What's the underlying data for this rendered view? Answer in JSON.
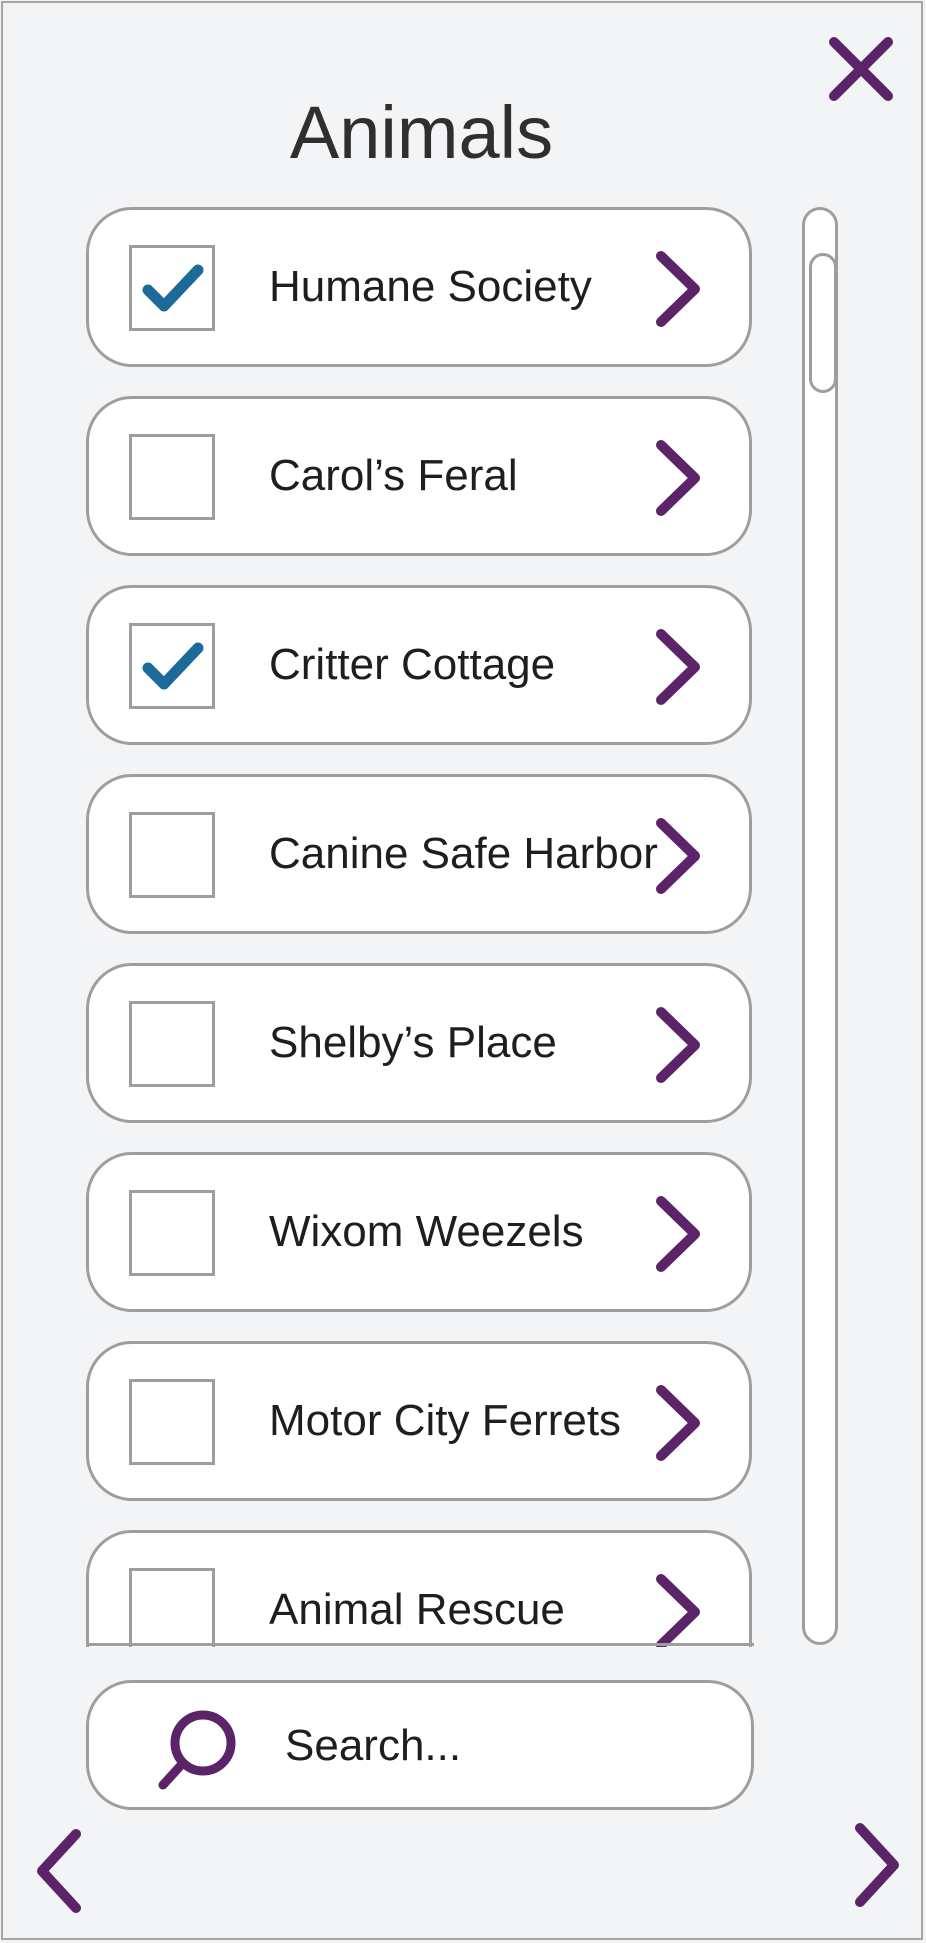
{
  "panel": {
    "title": "Animals",
    "close_icon": "close-icon",
    "accent_color": "#5c2468",
    "check_color": "#1c6a9a"
  },
  "list": {
    "items": [
      {
        "label": "Humane Society",
        "checked": true
      },
      {
        "label": "Carol’s Feral",
        "checked": false
      },
      {
        "label": "Critter Cottage",
        "checked": true
      },
      {
        "label": "Canine Safe Harbor",
        "checked": false
      },
      {
        "label": "Shelby’s Place",
        "checked": false
      },
      {
        "label": "Wixom Weezels",
        "checked": false
      },
      {
        "label": "Motor City Ferrets",
        "checked": false
      },
      {
        "label": "Animal Rescue",
        "checked": false
      }
    ],
    "item_icon": "chevron-right-icon"
  },
  "search": {
    "placeholder": "Search...",
    "value": "",
    "icon": "search-icon"
  },
  "footer": {
    "prev_icon": "chevron-left-icon",
    "next_icon": "chevron-right-icon"
  }
}
